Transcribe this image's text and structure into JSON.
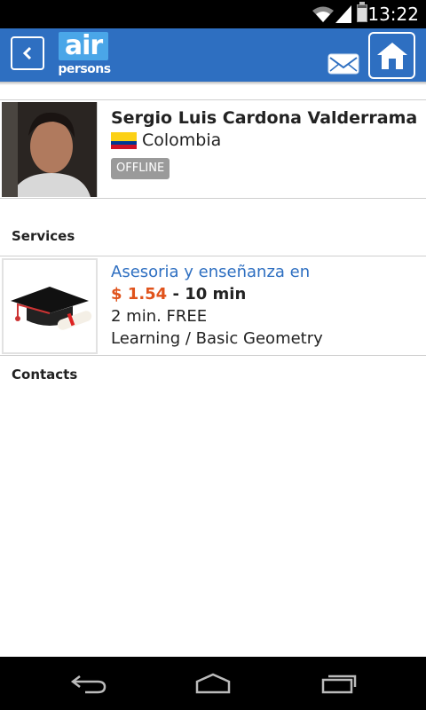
{
  "status_bar": {
    "time": "13:22",
    "battery_level": 0.85,
    "icons": [
      "wifi-icon",
      "cell-signal-icon",
      "battery-icon"
    ]
  },
  "app_bar": {
    "logo_top": "air",
    "logo_bottom": "persons",
    "icons": [
      "back-arrow-icon",
      "mail-icon",
      "home-icon"
    ],
    "colors": {
      "bar": "#2e6fc1",
      "logo": "#4aa6e8"
    }
  },
  "profile": {
    "name": "Sergio Luis Cardona Valderrama",
    "country": "Colombia",
    "status": "OFFLINE",
    "flag_colors": [
      "#fcd116",
      "#003893",
      "#ce1126"
    ]
  },
  "sections": {
    "services": "Services",
    "contacts": "Contacts"
  },
  "services": [
    {
      "title": "Asesoria y enseñanza en",
      "price": "$ 1.54",
      "duration": "- 10 min",
      "free_time": "2 min. FREE",
      "category": "Learning / Basic Geometry",
      "icon": "graduation-cap-icon"
    }
  ],
  "nav_bar": {
    "icons": [
      "nav-back-icon",
      "nav-home-icon",
      "nav-recents-icon"
    ]
  }
}
